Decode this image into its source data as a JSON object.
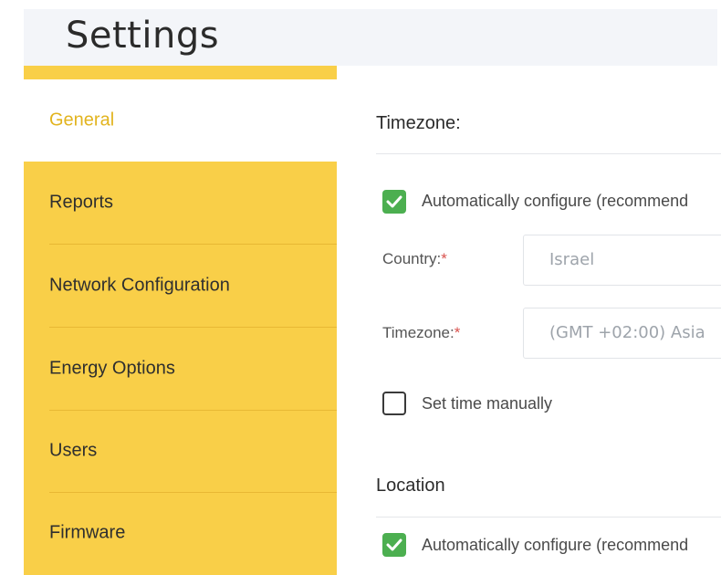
{
  "header": {
    "title": "Settings"
  },
  "sidebar": {
    "items": [
      {
        "label": "General"
      },
      {
        "label": "Reports"
      },
      {
        "label": "Network Configuration"
      },
      {
        "label": "Energy Options"
      },
      {
        "label": "Users"
      },
      {
        "label": "Firmware"
      }
    ]
  },
  "timezone": {
    "title": "Timezone:",
    "auto_label": "Automatically configure (recommend",
    "auto_checked": true,
    "country_label": "Country:",
    "country_value": "Israel",
    "timezone_label": "Timezone:",
    "timezone_value": "(GMT +02:00) Asia",
    "manual_label": "Set time manually",
    "manual_checked": false,
    "required_mark": "*"
  },
  "location": {
    "title": "Location",
    "auto_label": "Automatically configure (recommend",
    "auto_checked": true
  },
  "colors": {
    "sidebar_bg": "#f9cf48",
    "active_text": "#e2b41f",
    "check_green": "#4caf50",
    "required": "#d9534f"
  }
}
